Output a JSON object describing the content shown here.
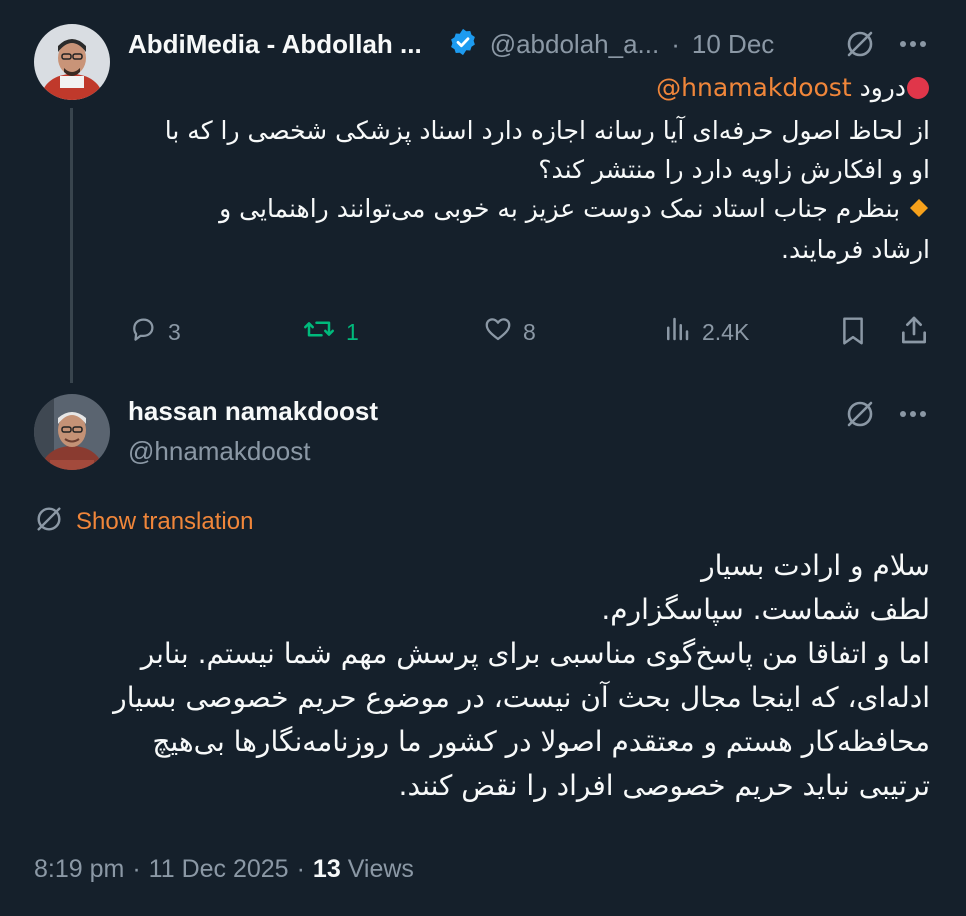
{
  "tweet1": {
    "author_name": "AbdiMedia - Abdollah ...",
    "handle": "@abdolah_a...",
    "separator": "·",
    "date": "10 Dec",
    "greeting": "درود",
    "mention": "@hnamakdoost",
    "line1": "از لحاظ اصول حرفه‌ای آیا رسانه اجازه دارد اسناد پزشکی شخصی را که با",
    "line2": "او و افکارش زاویه دارد را منتشر کند؟",
    "line3": "بنظرم جناب استاد نمک دوست عزیز به خوبی می‌توانند راهنمایی و",
    "line4": "ارشاد فرمایند.",
    "replies": "3",
    "reposts": "1",
    "likes": "8",
    "views": "2.4K",
    "colors": {
      "verified": "#1d9bf0",
      "repost_active": "#00ba7c",
      "accent": "#f0863a"
    }
  },
  "tweet2": {
    "author_name": "hassan namakdoost",
    "handle": "@hnamakdoost",
    "show_translation": "Show translation",
    "body_lines": [
      "سلام و ارادت بسیار",
      "لطف شماست. سپاسگزارم.",
      "اما و اتفاقا من پاسخ‌گوی مناسبی برای پرسش مهم شما نیستم. بنابر",
      "ادله‌ای، که اینجا مجال بحث آن نیست، در موضوع حریم خصوصی بسیار",
      "محافظه‌کار هستم و معتقدم اصولا در کشور ما روزنامه‌نگارها بی‌هیچ",
      "ترتیبی نباید حریم خصوصی افراد را نقض کنند."
    ],
    "time": "8:19 pm",
    "separator": "·",
    "date": "11 Dec 2025",
    "separator2": "·",
    "views_count": "13",
    "views_label": "Views"
  }
}
